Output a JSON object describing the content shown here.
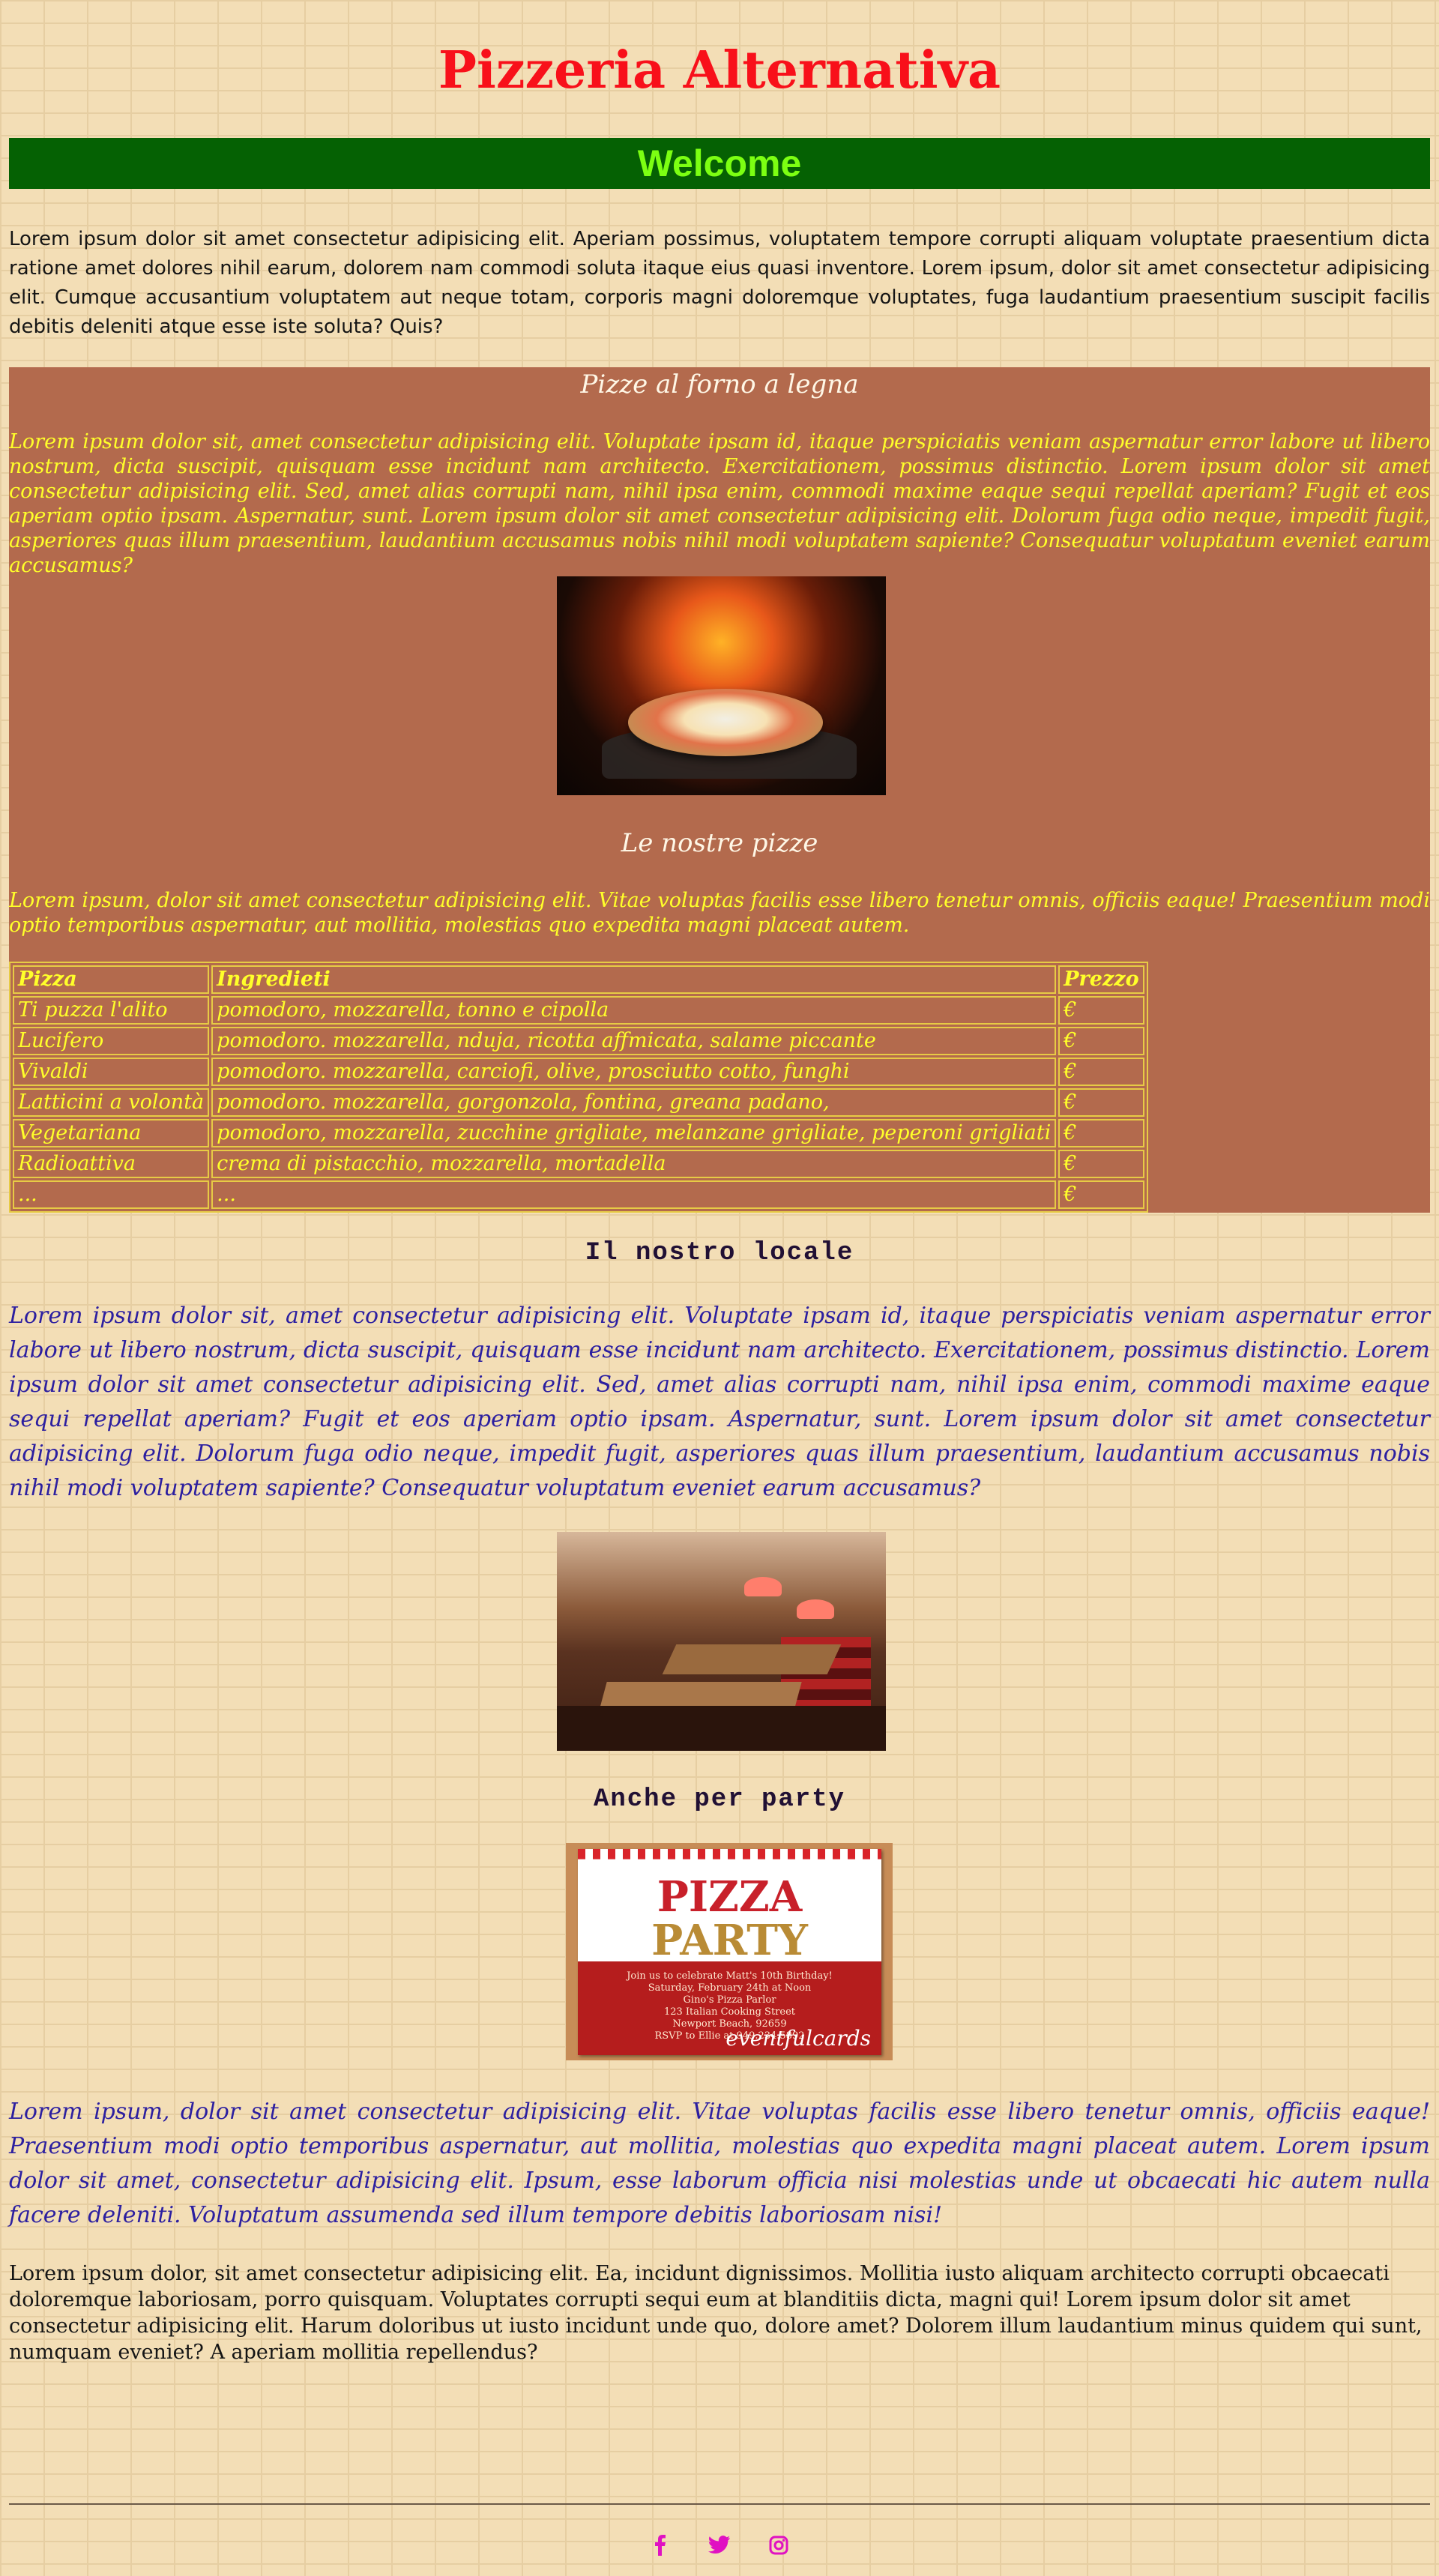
{
  "site_title": "Pizzeria Alternativa",
  "welcome": "Welcome",
  "intro": "Lorem ipsum dolor sit amet consectetur adipisicing elit. Aperiam possimus, voluptatem tempore corrupti aliquam voluptate praesentium dicta ratione amet dolores nihil earum, dolorem nam commodi soluta itaque eius quasi inventore. Lorem ipsum, dolor sit amet consectetur adipisicing elit. Cumque accusantium voluptatem aut neque totam, corporis magni doloremque voluptates, fuga laudantium praesentium suscipit facilis debitis deleniti atque esse iste soluta? Quis?",
  "oven_section": {
    "title": "Pizze al forno a legna",
    "text": "Lorem ipsum dolor sit, amet consectetur adipisicing elit. Voluptate ipsam id, itaque perspiciatis veniam aspernatur error labore ut libero nostrum, dicta suscipit, quisquam esse incidunt nam architecto. Exercitationem, possimus distinctio. Lorem ipsum dolor sit amet consectetur adipisicing elit. Sed, amet alias corrupti nam, nihil ipsa enim, commodi maxime eaque sequi repellat aperiam? Fugit et eos aperiam optio ipsam. Aspernatur, sunt. Lorem ipsum dolor sit amet consectetur adipisicing elit. Dolorum fuga odio neque, impedit fugit, asperiores quas illum praesentium, laudantium accusamus nobis nihil modi voluptatem sapiente? Consequatur voluptatum eveniet earum accusamus?",
    "menu_title": "Le nostre pizze",
    "menu_text": "Lorem ipsum, dolor sit amet consectetur adipisicing elit. Vitae voluptas facilis esse libero tenetur omnis, officiis eaque! Praesentium modi optio temporibus aspernatur, aut mollitia, molestias quo expedita magni placeat autem."
  },
  "menu_table": {
    "headers": [
      "Pizza",
      "Ingredieti",
      "Prezzo"
    ],
    "rows": [
      [
        "Ti puzza l'alito",
        "pomodoro, mozzarella, tonno e cipolla",
        "€"
      ],
      [
        "Lucifero",
        "pomodoro. mozzarella, nduja, ricotta affmicata, salame piccante",
        "€"
      ],
      [
        "Vivaldi",
        "pomodoro. mozzarella, carciofi, olive, prosciutto cotto, funghi",
        "€"
      ],
      [
        "Latticini a volontà",
        "pomodoro. mozzarella, gorgonzola, fontina, greana padano,",
        "€"
      ],
      [
        "Vegetariana",
        "pomodoro, mozzarella, zucchine grigliate, melanzane grigliate, peperoni grigliati",
        "€"
      ],
      [
        "Radioattiva",
        "crema di pistacchio, mozzarella, mortadella",
        "€"
      ],
      [
        "...",
        "...",
        "€"
      ]
    ]
  },
  "locale_section": {
    "title": "Il nostro locale",
    "text": "Lorem ipsum dolor sit, amet consectetur adipisicing elit. Voluptate ipsam id, itaque perspiciatis veniam aspernatur error labore ut libero nostrum, dicta suscipit, quisquam esse incidunt nam architecto. Exercitationem, possimus distinctio. Lorem ipsum dolor sit amet consectetur adipisicing elit. Sed, amet alias corrupti nam, nihil ipsa enim, commodi maxime eaque sequi repellat aperiam? Fugit et eos aperiam optio ipsam. Aspernatur, sunt. Lorem ipsum dolor sit amet consectetur adipisicing elit. Dolorum fuga odio neque, impedit fugit, asperiores quas illum praesentium, laudantium accusamus nobis nihil modi voluptatem sapiente? Consequatur voluptatum eveniet earum accusamus?"
  },
  "party_section": {
    "title": "Anche per party",
    "card": {
      "word1": "PIZZA",
      "word2": "PARTY",
      "line1": "Join us to celebrate Matt's 10th Birthday!",
      "line2": "Saturday, February 24th at Noon",
      "line3": "Gino's Pizza Parlor",
      "line4": "123 Italian Cooking Street",
      "line5": "Newport Beach, 92659",
      "line6": "RSVP to Ellie at 949.234.5892",
      "brand": "eventfulcards"
    },
    "text": "Lorem ipsum, dolor sit amet consectetur adipisicing elit. Vitae voluptas facilis esse libero tenetur omnis, officiis eaque! Praesentium modi optio temporibus aspernatur, aut mollitia, molestias quo expedita magni placeat autem. Lorem ipsum dolor sit amet, consectetur adipisicing elit. Ipsum, esse laborum officia nisi molestias unde ut obcaecati hic autem nulla facere deleniti. Voluptatum assumenda sed illum tempore debitis laboriosam nisi!"
  },
  "closing": "Lorem ipsum dolor, sit amet consectetur adipisicing elit. Ea, incidunt dignissimos. Mollitia iusto aliquam architecto corrupti obcaecati doloremque laboriosam, porro quisquam. Voluptates corrupti sequi eum at blanditiis dicta, magni qui! Lorem ipsum dolor sit amet consectetur adipisicing elit. Harum doloribus ut iusto incidunt unde quo, dolore amet? Dolorem illum laudantium minus quidem qui sunt, numquam eveniet? A aperiam mollitia repellendus?",
  "social": {
    "icons": [
      "facebook-icon",
      "twitter-icon",
      "instagram-icon"
    ],
    "color": "#e011c2"
  },
  "colors": {
    "title_red": "#f8101a",
    "welcome_bg": "#056103",
    "welcome_text": "#7cff12",
    "section_bg": "#b36a4d",
    "yellow_text": "#ffff2a",
    "blue_text": "#2c1fa0"
  }
}
